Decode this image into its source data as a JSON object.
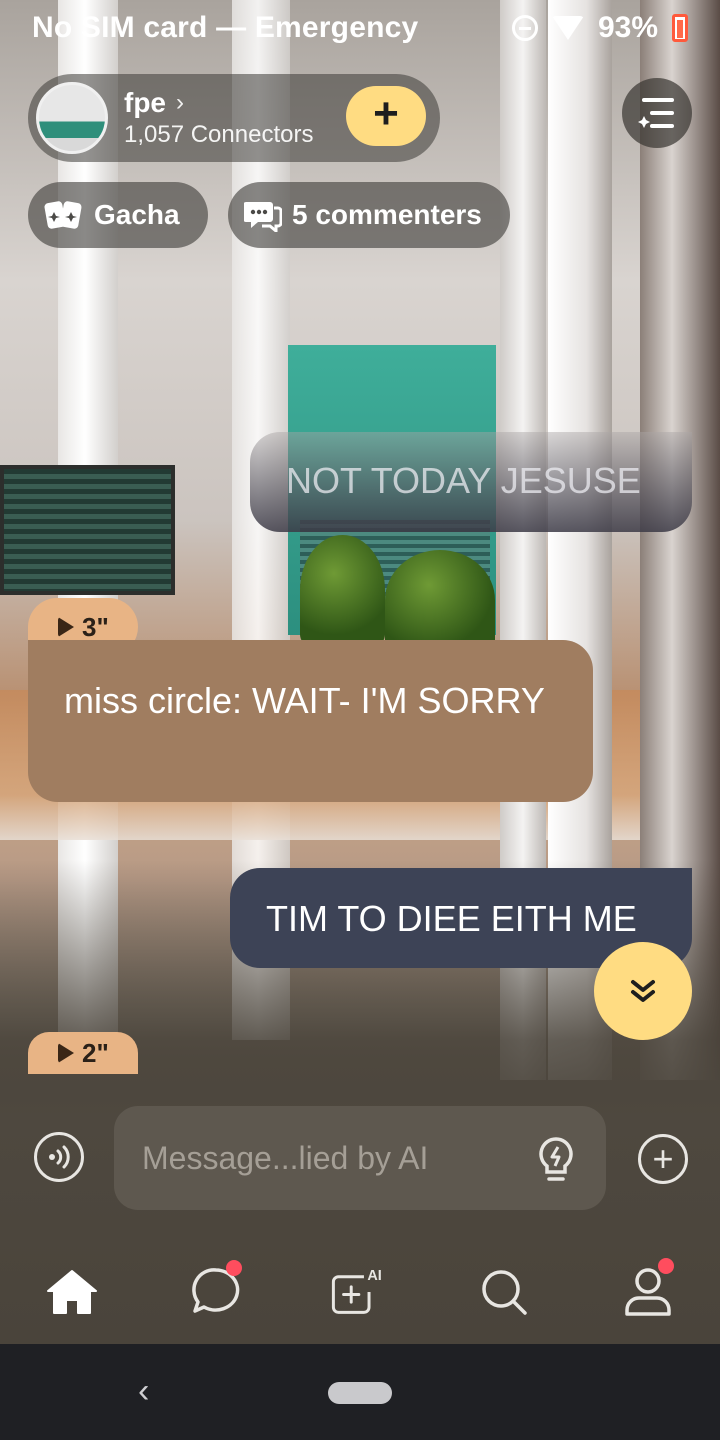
{
  "status_bar": {
    "carrier": "No SIM card — Emergency",
    "battery": "93%"
  },
  "header": {
    "chat_name": "fpe",
    "connectors": "1,057 Connectors",
    "join_icon": "plus-icon",
    "menu_icon": "menu-icon"
  },
  "chips": {
    "gacha": "Gacha",
    "commenters": "5 commenters"
  },
  "messages": [
    {
      "type": "outgoing",
      "text": "NOT TODAY JESUSE"
    },
    {
      "type": "incoming",
      "voice_duration": "3\"",
      "text": "miss circle: WAIT- I'M SORRY"
    },
    {
      "type": "outgoing",
      "text": "TIM TO DIEE EITH ME"
    },
    {
      "type": "incoming",
      "voice_duration": "2\""
    }
  ],
  "input": {
    "placeholder": "Message...lied by AI"
  },
  "bottom_nav": {
    "items": [
      "home-icon",
      "chat-icon",
      "ai-create-icon",
      "search-icon",
      "profile-icon"
    ]
  },
  "colors": {
    "accent": "#ffdc82",
    "incoming_bubble": "#a07d60",
    "outgoing_bubble": "#3d4356",
    "voice_tag": "#e8b485",
    "badge": "#ff4d5e"
  }
}
